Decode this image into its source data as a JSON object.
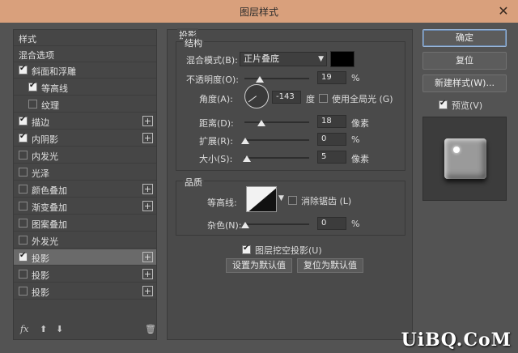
{
  "window": {
    "title": "图层样式",
    "close_icon": "close-icon"
  },
  "styles_list": {
    "header": "样式",
    "blend_options": "混合选项",
    "items": [
      {
        "label": "斜面和浮雕",
        "checked": true,
        "plus": false
      },
      {
        "label": "等高线",
        "checked": true,
        "plus": false,
        "indent": true
      },
      {
        "label": "纹理",
        "checked": false,
        "plus": false,
        "indent": true
      },
      {
        "label": "描边",
        "checked": true,
        "plus": true
      },
      {
        "label": "内阴影",
        "checked": true,
        "plus": true
      },
      {
        "label": "内发光",
        "checked": false,
        "plus": false
      },
      {
        "label": "光泽",
        "checked": false,
        "plus": false
      },
      {
        "label": "颜色叠加",
        "checked": false,
        "plus": true
      },
      {
        "label": "渐变叠加",
        "checked": false,
        "plus": true
      },
      {
        "label": "图案叠加",
        "checked": false,
        "plus": false
      },
      {
        "label": "外发光",
        "checked": false,
        "plus": false
      },
      {
        "label": "投影",
        "checked": true,
        "plus": true,
        "selected": true
      },
      {
        "label": "投影",
        "checked": false,
        "plus": true
      },
      {
        "label": "投影",
        "checked": false,
        "plus": true
      }
    ],
    "footer": {
      "fx": "fx",
      "up_icon": "arrow-up-icon",
      "down_icon": "arrow-down-icon",
      "trash_icon": "trash-icon"
    }
  },
  "drop_shadow": {
    "section_title": "投影",
    "structure": {
      "title": "结构",
      "blend_mode_label": "混合模式(B):",
      "blend_mode_value": "正片叠底",
      "color": "#000000",
      "opacity_label": "不透明度(O):",
      "opacity_value": "19",
      "opacity_unit": "%",
      "angle_label": "角度(A):",
      "angle_value": "-143",
      "angle_unit": "度",
      "global_light_label": "使用全局光 (G)",
      "global_light_checked": false,
      "distance_label": "距离(D):",
      "distance_value": "18",
      "distance_unit": "像素",
      "spread_label": "扩展(R):",
      "spread_value": "0",
      "spread_unit": "%",
      "size_label": "大小(S):",
      "size_value": "5",
      "size_unit": "像素"
    },
    "quality": {
      "title": "品质",
      "contour_label": "等高线:",
      "antialias_label": "消除锯齿 (L)",
      "antialias_checked": false,
      "noise_label": "杂色(N):",
      "noise_value": "0",
      "noise_unit": "%"
    },
    "knockout_label": "图层挖空投影(U)",
    "knockout_checked": true,
    "make_default": "设置为默认值",
    "reset_default": "复位为默认值"
  },
  "actions": {
    "ok": "确定",
    "reset": "复位",
    "new_style": "新建样式(W)...",
    "preview_label": "预览(V)",
    "preview_checked": true
  },
  "watermark": "UiBQ.CoM"
}
